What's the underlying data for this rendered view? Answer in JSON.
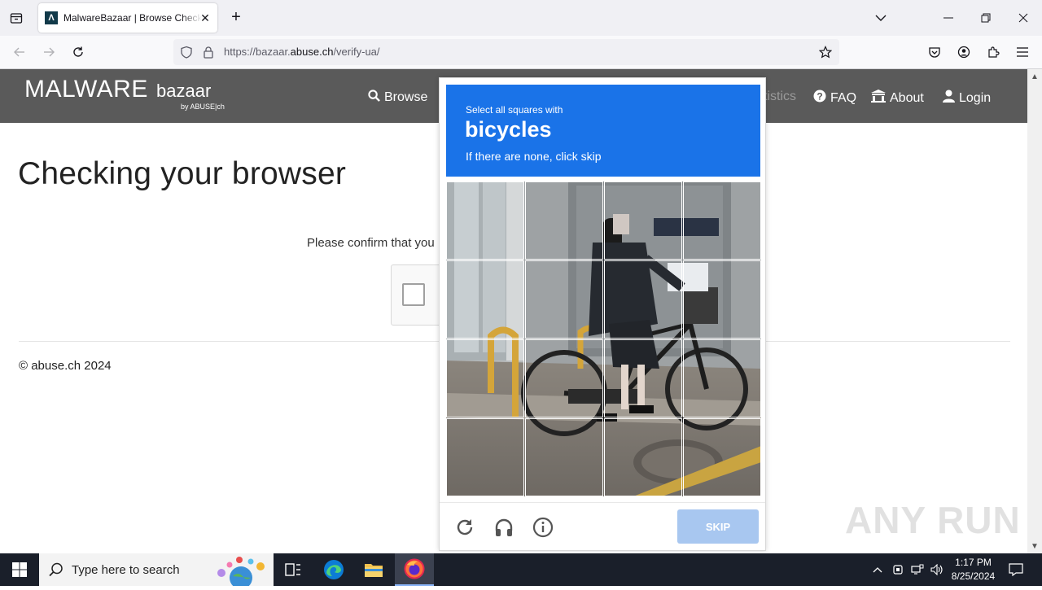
{
  "browser": {
    "tab": {
      "favicon": "Λ",
      "title": "MalwareBazaar | Browse Checking"
    },
    "url": {
      "prefix": "https://bazaar.",
      "host": "abuse.ch",
      "path": "/verify-ua/"
    }
  },
  "site": {
    "logo": {
      "main": "MALWARE",
      "sub": "bazaar",
      "by": "by ABUSE|ch"
    },
    "nav": {
      "browse": "Browse",
      "statistics": "Statistics",
      "faq": "FAQ",
      "about": "About",
      "login": "Login"
    },
    "title": "Checking your browser",
    "confirm": "Please confirm that you",
    "footer": "© abuse.ch 2024"
  },
  "captcha": {
    "line1": "Select all squares with",
    "target": "bicycles",
    "line3": "If there are none, click skip",
    "skip": "SKIP",
    "icons": [
      "refresh-icon",
      "headphones-icon",
      "info-icon"
    ]
  },
  "watermark": "ANY RUN",
  "taskbar": {
    "search_placeholder": "Type here to search",
    "time": "1:17 PM",
    "date": "8/25/2024"
  },
  "colors": {
    "captcha_blue": "#1a73e8",
    "skip_disabled": "#a8c7f0",
    "header_gray": "#5a5a5a"
  }
}
